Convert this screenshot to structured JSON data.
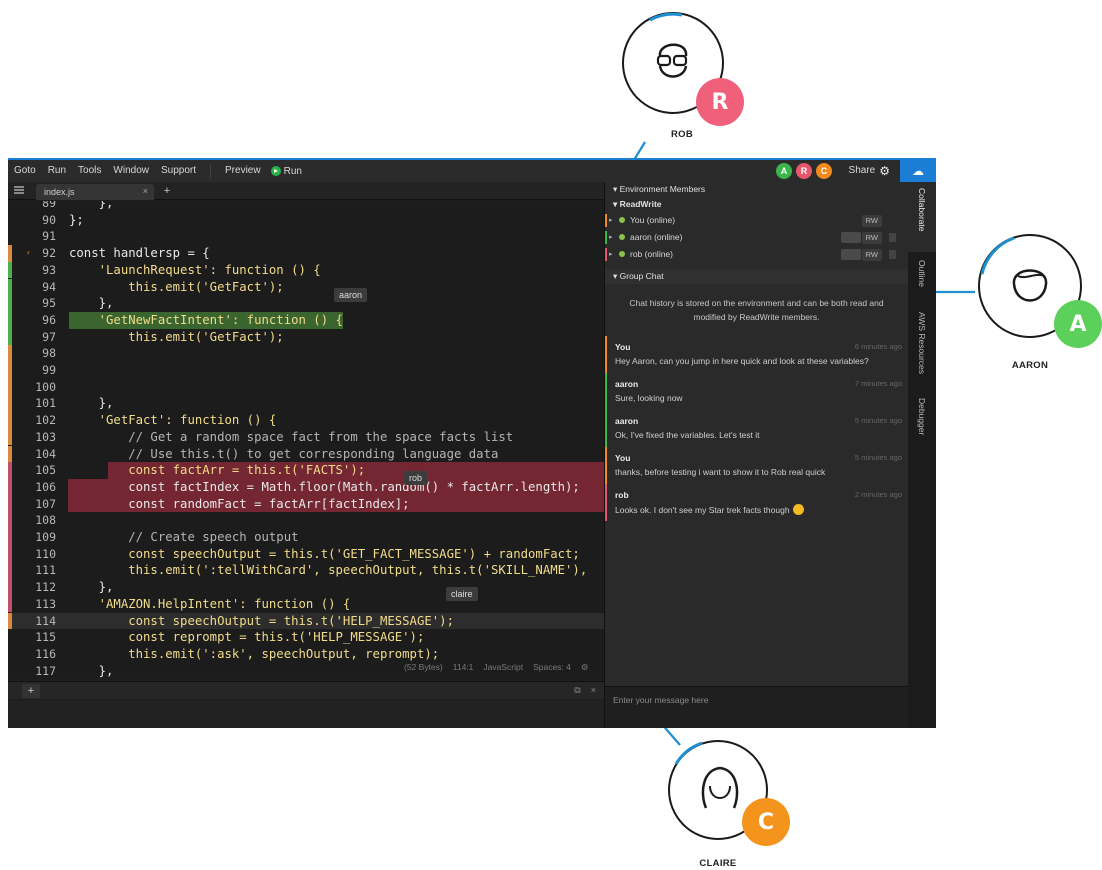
{
  "menu": {
    "items": [
      "Goto",
      "Run",
      "Tools",
      "Window",
      "Support"
    ],
    "preview": "Preview",
    "run": "Run",
    "share": "Share",
    "avatars": [
      {
        "letter": "A",
        "color": "#3cb54a"
      },
      {
        "letter": "R",
        "color": "#e8566d"
      },
      {
        "letter": "C",
        "color": "#f08a1c"
      }
    ]
  },
  "tabs": {
    "file": "index.js",
    "close": "×",
    "add": "+"
  },
  "editor": {
    "lines": [
      {
        "n": "89",
        "text": "    },",
        "mark": ""
      },
      {
        "n": "90",
        "text": "};",
        "mark": ""
      },
      {
        "n": "91",
        "text": "",
        "mark": ""
      },
      {
        "n": "92",
        "text": "const handlersp = {",
        "mark": "orange"
      },
      {
        "n": "93",
        "text": "    'LaunchRequest': function () {",
        "mark": "green"
      },
      {
        "n": "94",
        "text": "        this.emit('GetFact');",
        "mark": "green"
      },
      {
        "n": "95",
        "text": "    },",
        "mark": "green"
      },
      {
        "n": "96",
        "text": "    'GetNewFactIntent': function () {",
        "mark": "green"
      },
      {
        "n": "97",
        "text": "        this.emit('GetFact');",
        "mark": "green"
      },
      {
        "n": "98",
        "text": "",
        "mark": "orange"
      },
      {
        "n": "99",
        "text": "",
        "mark": "orange"
      },
      {
        "n": "100",
        "text": "",
        "mark": "orange"
      },
      {
        "n": "101",
        "text": "    },",
        "mark": "orange"
      },
      {
        "n": "102",
        "text": "    'GetFact': function () {",
        "mark": "orange"
      },
      {
        "n": "103",
        "text": "        // Get a random space fact from the space facts list",
        "mark": "orange"
      },
      {
        "n": "104",
        "text": "        // Use this.t() to get corresponding language data",
        "mark": "orange"
      },
      {
        "n": "105",
        "text": "        const factArr = this.t('FACTS');",
        "mark": "pink"
      },
      {
        "n": "106",
        "text": "        const factIndex = Math.floor(Math.random() * factArr.length);",
        "mark": "pink"
      },
      {
        "n": "107",
        "text": "        const randomFact = factArr[factIndex];",
        "mark": "pink"
      },
      {
        "n": "108",
        "text": "",
        "mark": "pink"
      },
      {
        "n": "109",
        "text": "        // Create speech output",
        "mark": "pink"
      },
      {
        "n": "110",
        "text": "        const speechOutput = this.t('GET_FACT_MESSAGE') + randomFact;",
        "mark": "pink"
      },
      {
        "n": "111",
        "text": "        this.emit(':tellWithCard', speechOutput, this.t('SKILL_NAME'),",
        "mark": "pink"
      },
      {
        "n": "112",
        "text": "    },",
        "mark": "pink"
      },
      {
        "n": "113",
        "text": "    'AMAZON.HelpIntent': function () {",
        "mark": "pink"
      },
      {
        "n": "114",
        "text": "        const speechOutput = this.t('HELP_MESSAGE');",
        "mark": "orange"
      },
      {
        "n": "115",
        "text": "        const reprompt = this.t('HELP_MESSAGE');",
        "mark": ""
      },
      {
        "n": "116",
        "text": "        this.emit(':ask', speechOutput, reprompt);",
        "mark": ""
      },
      {
        "n": "117",
        "text": "    },",
        "mark": ""
      }
    ],
    "cursors": {
      "aaron": "aaron",
      "rob": "rob",
      "claire": "claire"
    },
    "status": {
      "size": "(52 Bytes)",
      "pos": "114:1",
      "lang": "JavaScript",
      "spaces": "Spaces: 4"
    }
  },
  "bottom": {
    "add": "+"
  },
  "collab": {
    "env_header": "Environment Members",
    "readwrite_header": "ReadWrite",
    "members": [
      {
        "name": "You (online)",
        "rw": "RW"
      },
      {
        "name": "aaron (online)",
        "rw": "RW"
      },
      {
        "name": "rob (online)",
        "rw": "RW"
      }
    ],
    "group_chat": "Group Chat",
    "chat_note": "Chat history is stored on the environment and can be both read and modified by ReadWrite members.",
    "messages": [
      {
        "who": "You",
        "time": "6 minutes ago",
        "body": "Hey Aaron, can you jump in here quick and look at these variables?"
      },
      {
        "who": "aaron",
        "time": "7 minutes ago",
        "body": "Sure, looking now"
      },
      {
        "who": "aaron",
        "time": "5 minutes ago",
        "body": "Ok, I've fixed the variables. Let's test it"
      },
      {
        "who": "You",
        "time": "5 minutes ago",
        "body": "thanks, before testing i want to show it to Rob real quick"
      },
      {
        "who": "rob",
        "time": "2 minutes ago",
        "body": "Looks ok. I don't see my Star trek facts though"
      }
    ],
    "input_placeholder": "Enter your message here"
  },
  "vtabs": [
    "Collaborate",
    "Outline",
    "AWS Resources",
    "Debugger"
  ],
  "personas": {
    "rob": {
      "name": "ROB",
      "letter": "R",
      "color": "#f0607a"
    },
    "aaron": {
      "name": "AARON",
      "letter": "A",
      "color": "#5bd05b"
    },
    "claire": {
      "name": "CLAIRE",
      "letter": "C",
      "color": "#f5941d"
    }
  },
  "colors": {
    "accent": "#1a7fd4",
    "connector": "#1e8fd0"
  }
}
